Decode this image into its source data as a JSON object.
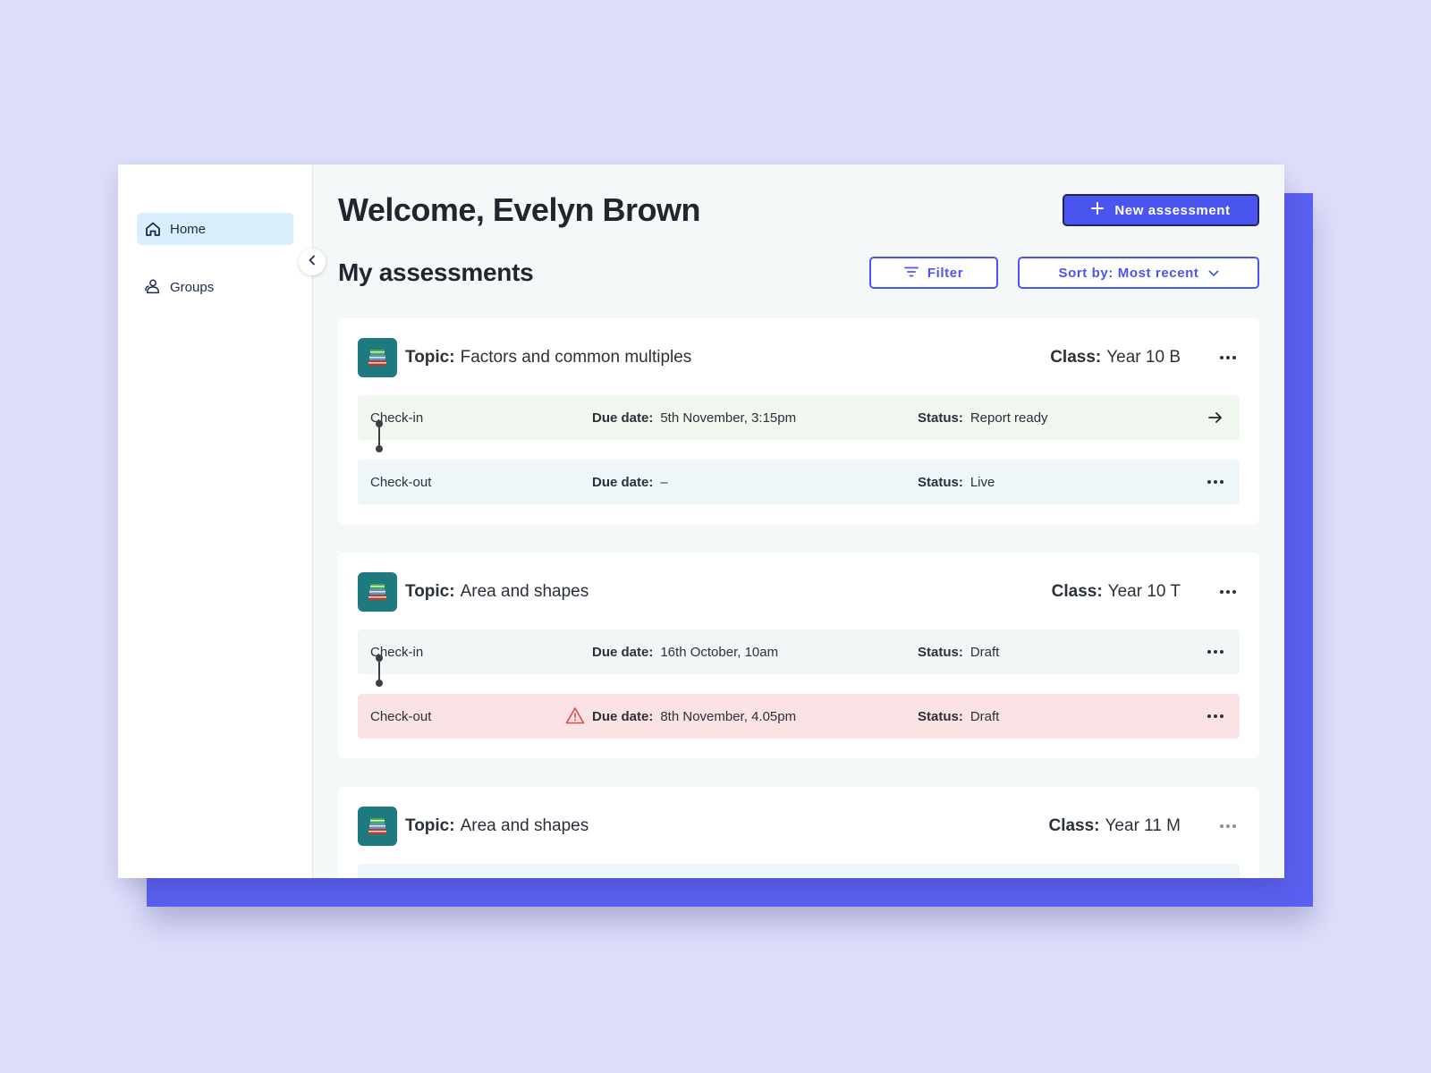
{
  "sidebar": {
    "items": [
      {
        "label": "Home",
        "icon": "home-icon",
        "active": true
      },
      {
        "label": "Groups",
        "icon": "groups-icon",
        "active": false
      }
    ]
  },
  "header": {
    "title": "Welcome, Evelyn Brown",
    "new_assessment_label": "New assessment"
  },
  "assessments": {
    "title": "My assessments",
    "filter_label": "Filter",
    "sort_label": "Sort by: Most recent"
  },
  "labels": {
    "topic": "Topic:",
    "class": "Class:",
    "due_date": "Due date:",
    "status": "Status:"
  },
  "cards": [
    {
      "topic": "Factors and common multiples",
      "class": "Year 10 B",
      "rows": [
        {
          "stage": "Check-in",
          "due": "5th November, 3:15pm",
          "status": "Report ready"
        },
        {
          "stage": "Check-out",
          "due": "–",
          "status": "Live"
        }
      ]
    },
    {
      "topic": "Area and shapes",
      "class": "Year 10 T",
      "rows": [
        {
          "stage": "Check-in",
          "due": "16th October, 10am",
          "status": "Draft"
        },
        {
          "stage": "Check-out",
          "due": "8th November, 4.05pm",
          "status": "Draft"
        }
      ]
    },
    {
      "topic": "Area and shapes",
      "class": "Year 11 M"
    }
  ],
  "colors": {
    "background": "#dedefc",
    "accent": "#4a55f0",
    "backdrop": "#5b5ff0",
    "row_report_ready": "#eff7ef",
    "row_overdue": "#fbe3e5",
    "topic_icon_bg": "#1f7a80",
    "warning": "#e04848"
  }
}
